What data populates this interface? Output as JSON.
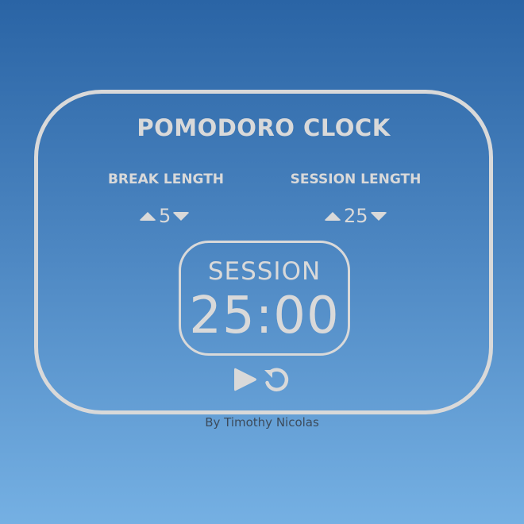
{
  "app": {
    "title": "POMODORO CLOCK"
  },
  "break": {
    "label": "BREAK LENGTH",
    "value": "5",
    "increment_icon": "triangle-up-icon",
    "decrement_icon": "triangle-down-icon"
  },
  "session": {
    "label": "SESSION LENGTH",
    "value": "25",
    "increment_icon": "triangle-up-icon",
    "decrement_icon": "triangle-down-icon"
  },
  "timer": {
    "label": "SESSION",
    "time": "25:00"
  },
  "controls": {
    "play_icon": "play-icon",
    "reset_icon": "reset-icon"
  },
  "footer": {
    "credit": "By Timothy Nicolas"
  },
  "colors": {
    "foreground": "#d9d9d9",
    "background_top": "#2a64a5",
    "background_bottom": "#75b0e3",
    "credit_text": "#3c4b5c"
  }
}
